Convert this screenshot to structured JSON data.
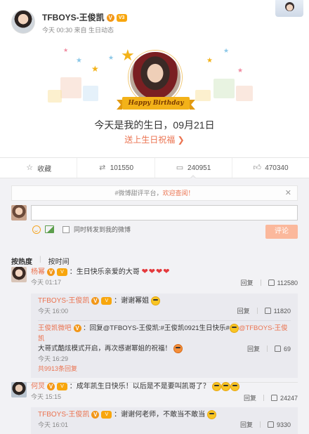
{
  "header": {
    "author": "TFBOYS-王俊凯",
    "v_badge": "V",
    "level_badge": "V3",
    "meta": "今天 00:30 来自 生日动态"
  },
  "banner": {
    "ribbon": "Happy Birthday",
    "text": "今天是我的生日，09月21日",
    "link": "送上生日祝福 ❯"
  },
  "actions": {
    "favorite": "收藏",
    "repost": "101550",
    "comment": "240951",
    "like": "470340"
  },
  "notice": {
    "prefix": "#微博甜评平台，",
    "highlight": "欢迎查阅！",
    "close": "✕"
  },
  "composer": {
    "sync_label": "同时转发到我的微博",
    "submit": "评论"
  },
  "sort": {
    "hot": "按热度",
    "time": "按时间"
  },
  "comments": [
    {
      "user": "杨幂",
      "text": "：生日快乐亲爱的大哥",
      "time": "今天 01:17",
      "reply": "回复",
      "likes": "112580",
      "replies": [
        {
          "user": "TFBOYS-王俊凯",
          "text": "：谢谢幂姐",
          "time": "今天 16:00",
          "reply": "回复",
          "likes": "11820"
        },
        {
          "user": "王俊凯微吧",
          "text": "：回复@TFBOYS-王俊凯:#王俊凯0921生日快乐#",
          "text2": "@TFBOYS-王俊凯",
          "line2": "大哥式酷炫模式开启，再次感谢幂姐的祝福！",
          "time": "今天 16:29",
          "reply": "回复",
          "likes": "69"
        }
      ],
      "more": "共9913条回复"
    },
    {
      "user": "何炅",
      "text": "：成年凯生日快乐！以后是不是要叫凯哥了？",
      "time": "今天 15:15",
      "reply": "回复",
      "likes": "24247",
      "replies": [
        {
          "user": "TFBOYS-王俊凯",
          "text": "：谢谢何老师，不敢当不敢当",
          "time": "今天 16:01",
          "reply": "回复",
          "likes": "9330"
        }
      ]
    }
  ],
  "colors": {
    "accent": "#eb7350",
    "badge": "#f29718",
    "bg": "#f2f2f5"
  }
}
